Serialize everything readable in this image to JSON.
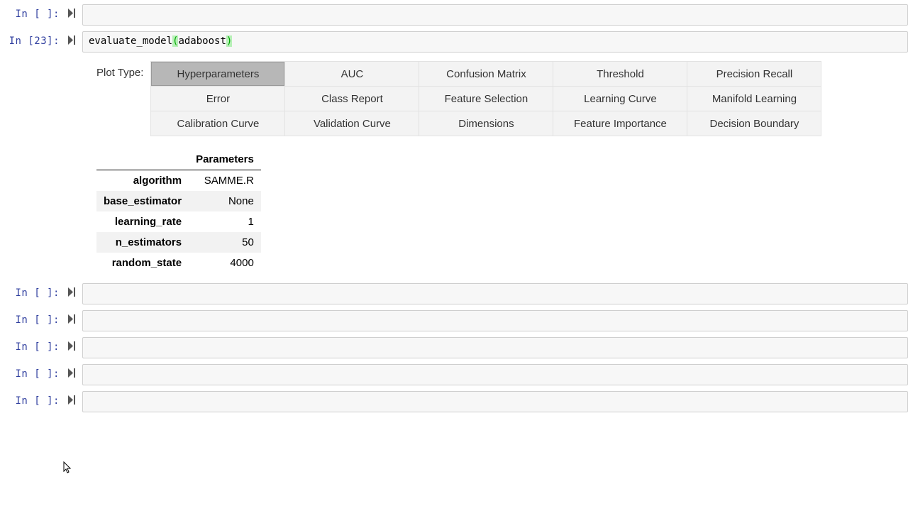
{
  "cells": {
    "empty_prompt": "In [ ]:",
    "c23_prompt": "In [23]:",
    "c23_code": {
      "fn": "evaluate_model",
      "lp": "(",
      "arg": "adaboost",
      "rp": ")"
    }
  },
  "plot_type_label": "Plot Type:",
  "toggles": {
    "r0c0": "Hyperparameters",
    "r0c1": "AUC",
    "r0c2": "Confusion Matrix",
    "r0c3": "Threshold",
    "r0c4": "Precision Recall",
    "r1c0": "Error",
    "r1c1": "Class Report",
    "r1c2": "Feature Selection",
    "r1c3": "Learning Curve",
    "r1c4": "Manifold Learning",
    "r2c0": "Calibration Curve",
    "r2c1": "Validation Curve",
    "r2c2": "Dimensions",
    "r2c3": "Feature Importance",
    "r2c4": "Decision Boundary"
  },
  "params_header_blank": "",
  "params_header": "Parameters",
  "params": [
    {
      "name": "algorithm",
      "value": "SAMME.R"
    },
    {
      "name": "base_estimator",
      "value": "None"
    },
    {
      "name": "learning_rate",
      "value": "1"
    },
    {
      "name": "n_estimators",
      "value": "50"
    },
    {
      "name": "random_state",
      "value": "4000"
    }
  ]
}
